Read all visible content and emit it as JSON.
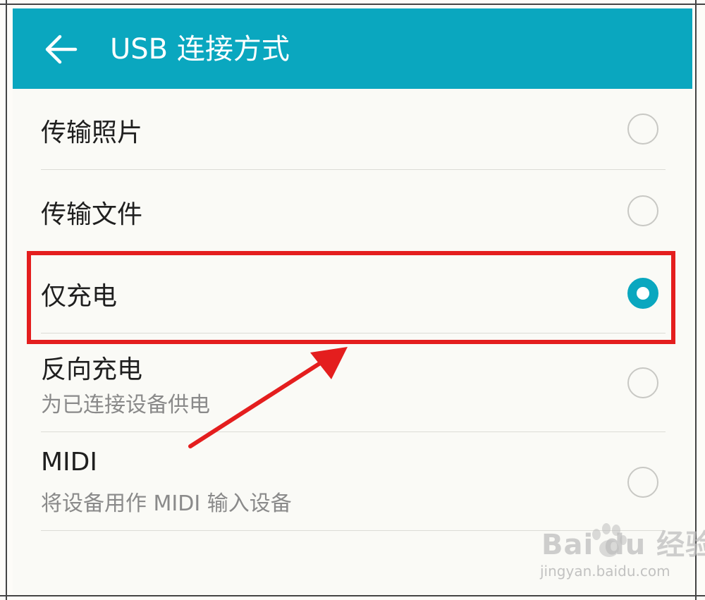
{
  "header": {
    "title": "USB 连接方式",
    "back_icon": "arrow-left-icon",
    "color": "#0aa7bf"
  },
  "options": [
    {
      "label": "传输照片",
      "subtitle": "",
      "selected": false
    },
    {
      "label": "传输文件",
      "subtitle": "",
      "selected": false
    },
    {
      "label": "仅充电",
      "subtitle": "",
      "selected": true
    },
    {
      "label": "反向充电",
      "subtitle": "为已连接设备供电",
      "selected": false
    },
    {
      "label": "MIDI",
      "subtitle": "将设备用作 MIDI 输入设备",
      "selected": false
    }
  ],
  "annotation": {
    "highlight_color": "#e41e1e",
    "highlighted_option": "仅充电",
    "arrow": "red arrow pointing to highlighted option"
  },
  "watermark": {
    "brand": "Bai du 经验",
    "url": "jingyan.baidu.com"
  }
}
